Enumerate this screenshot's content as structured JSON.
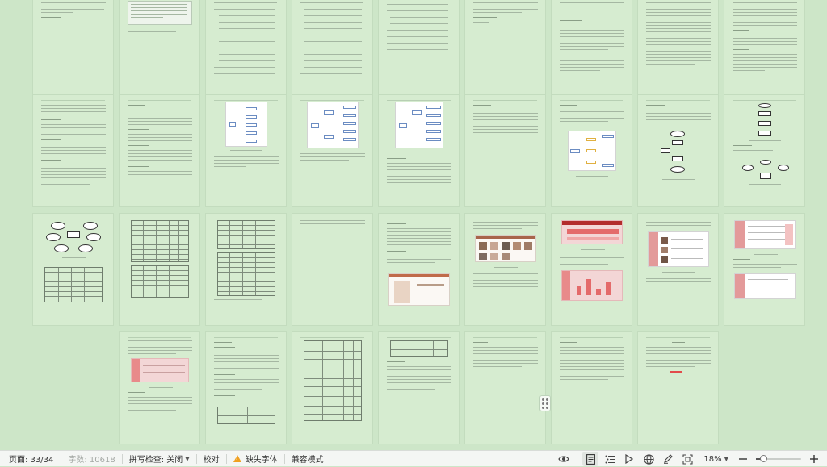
{
  "statusbar": {
    "page_label": "页面: 33/34",
    "word_count_label": "字数: 10618",
    "spell_check_label": "拼写检查: 关闭",
    "proofread_label": "校对",
    "missing_font_label": "缺失字体",
    "compat_mode_label": "兼容模式",
    "zoom_label": "18%",
    "zoom_level": 0.18
  },
  "icons": {
    "warning": "warning-icon",
    "eye": "eye-protection-icon",
    "page_view": "page-view-icon",
    "outline": "outline-view-icon",
    "play": "play-icon",
    "globe": "web-layout-icon",
    "pen": "pen-icon",
    "fit": "fit-page-icon",
    "zoom_out": "zoom-out-icon",
    "zoom_in": "zoom-in-icon"
  },
  "colors": {
    "workspace_bg": "#cde6c8",
    "page_bg": "#d6ecd0",
    "statusbar_bg": "#f4f6f4",
    "warning": "#f0a020"
  }
}
